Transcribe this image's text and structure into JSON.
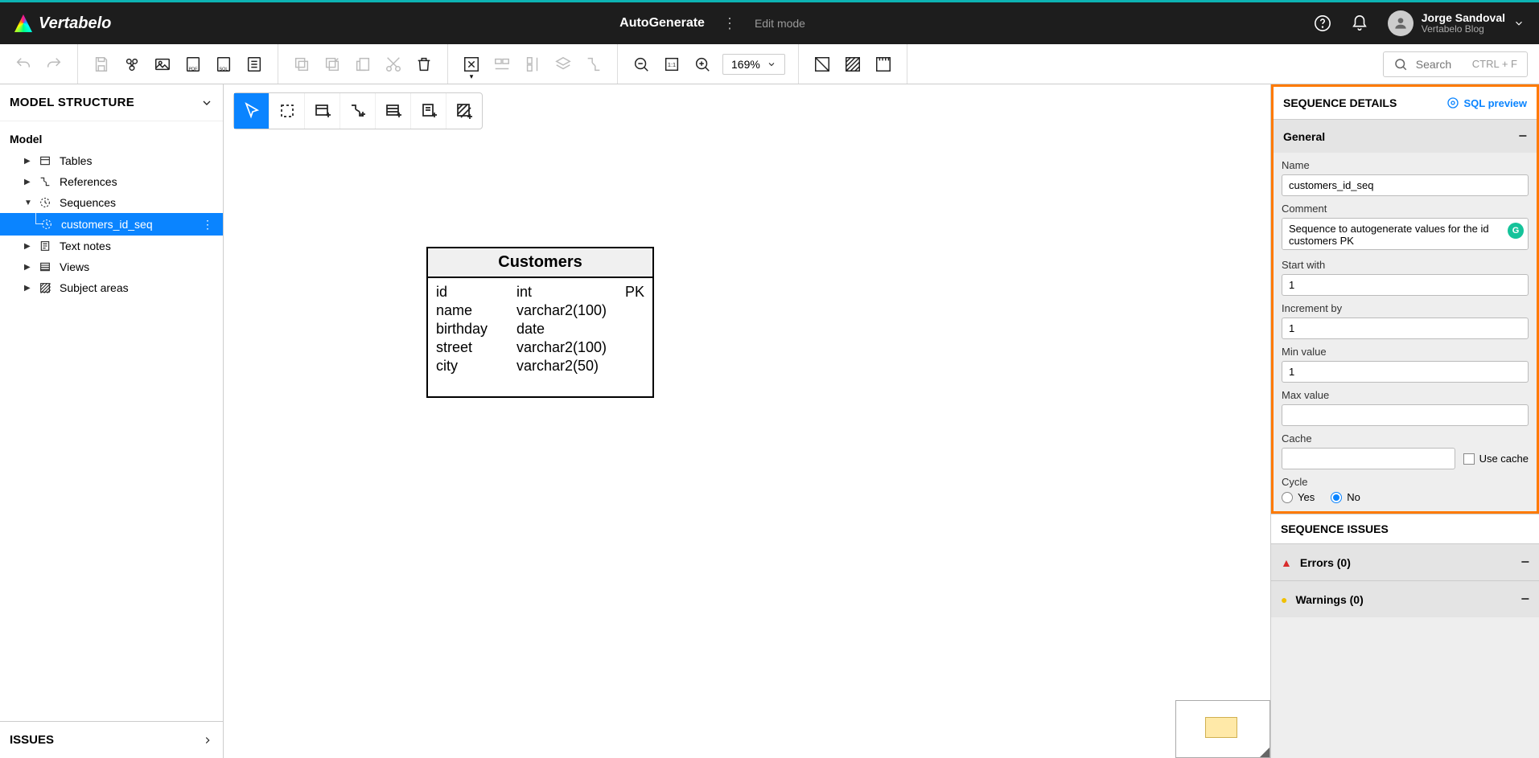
{
  "app": {
    "brand": "Vertabelo"
  },
  "header": {
    "doc_title": "AutoGenerate",
    "mode": "Edit mode",
    "user_name": "Jorge Sandoval",
    "user_sub": "Vertabelo Blog"
  },
  "toolbar": {
    "zoom": "169%",
    "search_placeholder": "Search",
    "search_hint": "CTRL + F"
  },
  "left": {
    "panel_title": "MODEL STRUCTURE",
    "root": "Model",
    "items": {
      "tables": "Tables",
      "references": "References",
      "sequences": "Sequences",
      "textnotes": "Text notes",
      "views": "Views",
      "subjectareas": "Subject areas"
    },
    "selected_sequence": "customers_id_seq",
    "issues_title": "ISSUES"
  },
  "entity": {
    "title": "Customers",
    "rows": [
      {
        "name": "id",
        "type": "int",
        "key": "PK"
      },
      {
        "name": "name",
        "type": "varchar2(100)",
        "key": ""
      },
      {
        "name": "birthday",
        "type": "date",
        "key": ""
      },
      {
        "name": "street",
        "type": "varchar2(100)",
        "key": ""
      },
      {
        "name": "city",
        "type": "varchar2(50)",
        "key": ""
      }
    ]
  },
  "right": {
    "title": "SEQUENCE DETAILS",
    "sql_preview": "SQL preview",
    "general_label": "General",
    "labels": {
      "name": "Name",
      "comment": "Comment",
      "start": "Start with",
      "increment": "Increment by",
      "min": "Min value",
      "max": "Max value",
      "cache": "Cache",
      "use_cache": "Use cache",
      "cycle": "Cycle",
      "yes": "Yes",
      "no": "No"
    },
    "values": {
      "name": "customers_id_seq",
      "comment": "Sequence to autogenerate values for the id customers PK",
      "start": "1",
      "increment": "1",
      "min": "1",
      "max": "",
      "cache": ""
    },
    "issues_title": "SEQUENCE ISSUES",
    "errors": "Errors (0)",
    "warnings": "Warnings (0)"
  }
}
